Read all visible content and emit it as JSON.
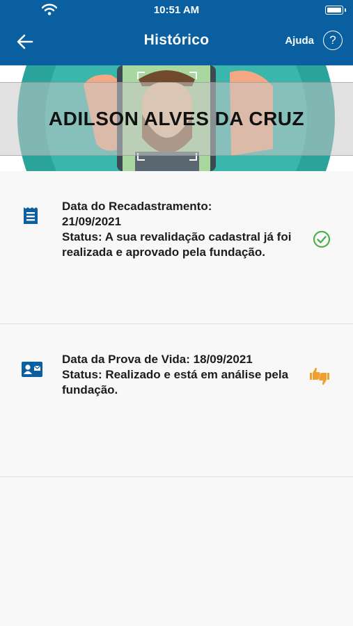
{
  "status_bar": {
    "time": "10:51 AM"
  },
  "header": {
    "title": "Histórico",
    "help_label": "Ajuda",
    "help_icon_glyph": "?"
  },
  "profile": {
    "name": "ADILSON ALVES DA CRUZ"
  },
  "records": [
    {
      "icon": "document-icon",
      "line1": "Data do Recadastramento:",
      "line2": "21/09/2021",
      "status": "Status: A sua revalidação cadastral já foi realizada e aprovado pela fundação.",
      "status_icon": "check-circle-icon",
      "status_color": "#4caf50"
    },
    {
      "icon": "id-card-icon",
      "line1": "Data da Prova de Vida: 18/09/2021",
      "status": "Status: Realizado e está em análise pela fundação.",
      "status_icon": "thumbs-up-down-icon",
      "status_color": "#f0a030"
    }
  ],
  "colors": {
    "header": "#0a5fa0",
    "accent_icon": "#0a5fa0"
  }
}
